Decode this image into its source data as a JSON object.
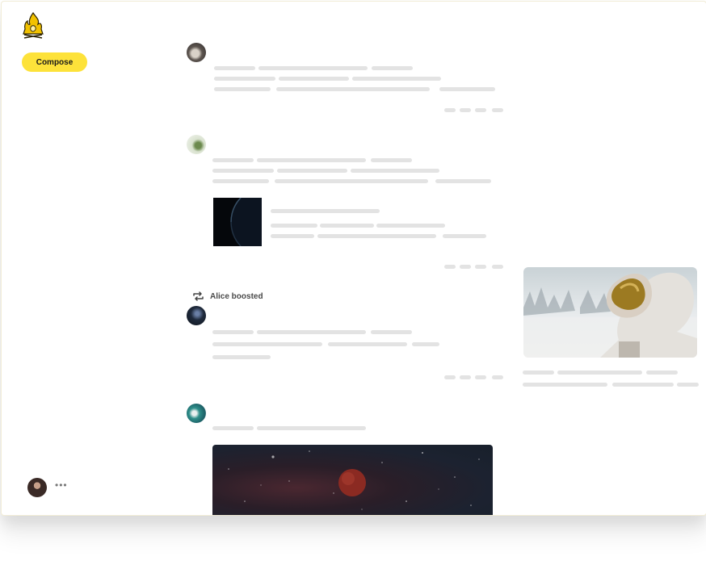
{
  "sidebar": {
    "logo_icon": "campfire-logo-icon",
    "compose_label": "Compose",
    "more_label": "•••",
    "accent_color": "#fde23a"
  },
  "feed": {
    "boost_label": "Alice boosted",
    "boost_icon": "repost-icon"
  }
}
